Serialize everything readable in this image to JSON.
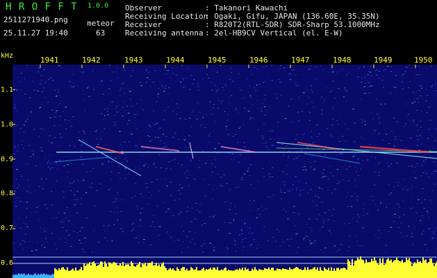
{
  "app": {
    "name": "H R O F F T",
    "version": "1.0.0"
  },
  "file": {
    "name": "2511271940.png",
    "datetime": "25.11.27 19:40"
  },
  "meteor": {
    "label": "meteor",
    "count": "63"
  },
  "info": [
    {
      "key": "Observer",
      "value": ": Takanori Kawachi"
    },
    {
      "key": "Receiving Location",
      "value": ": Ogaki, Gifu, JAPAN (136.60E, 35.35N)"
    },
    {
      "key": "Receiver",
      "value": ": R820T2(RTL-SDR) SDR-Sharp 53.1000MHz"
    },
    {
      "key": "Receiving antenna",
      "value": ": 2el-HB9CV Vertical (el. E-W)"
    }
  ],
  "axis": {
    "y_unit": "kHz",
    "y_ticks": [
      "1.1",
      "1.0",
      "0.9",
      "0.8",
      "0.7",
      "0.6"
    ],
    "x_ticks": [
      "1941",
      "1942",
      "1943",
      "1944",
      "1945",
      "1946",
      "1947",
      "1948",
      "1949",
      "1950"
    ]
  },
  "colors": {
    "background": "#0a0a6a",
    "text_green": "#3df03d",
    "text_yellow": "#ffff33",
    "signal": "#ffff33"
  }
}
